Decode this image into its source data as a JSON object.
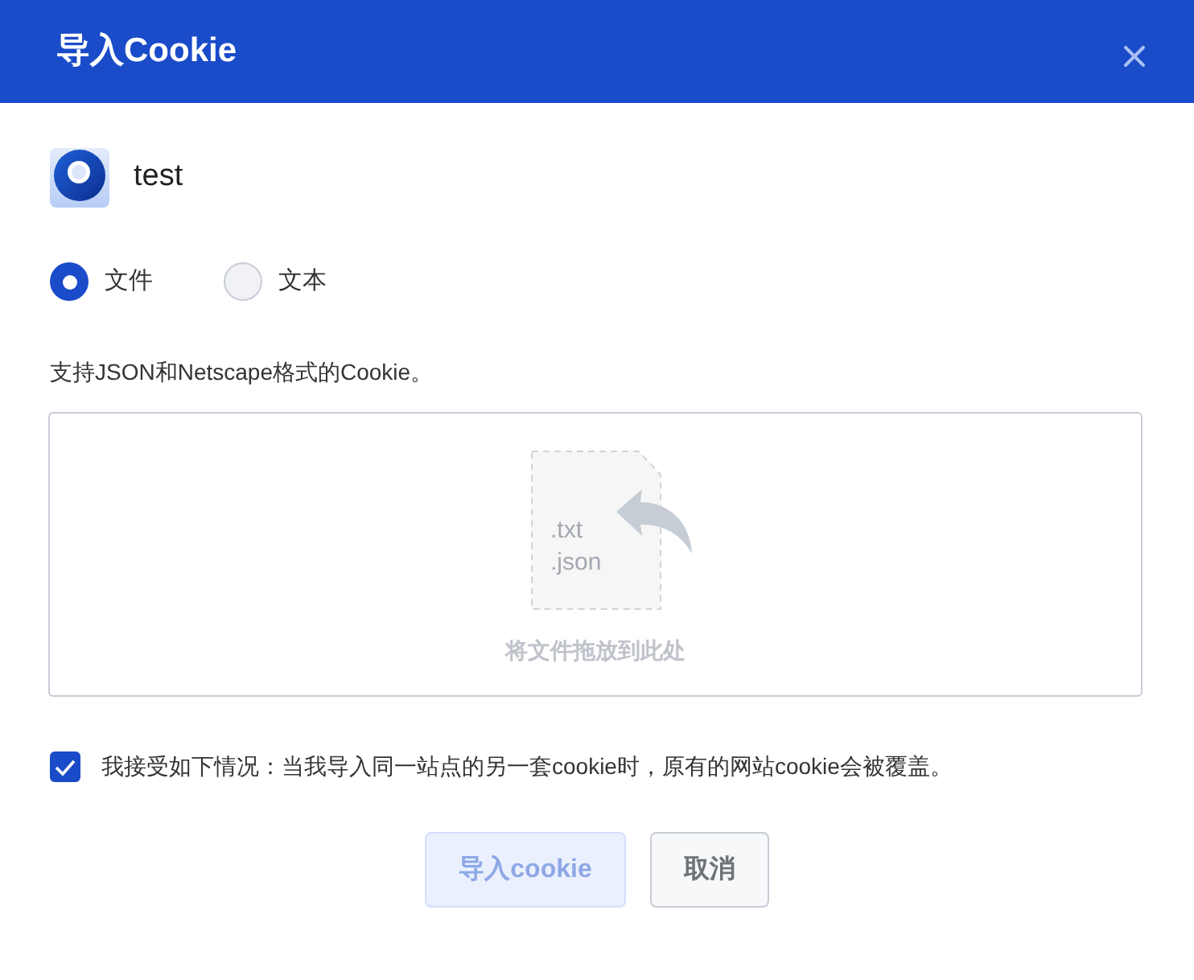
{
  "dialog": {
    "title": "导入Cookie"
  },
  "profile": {
    "name": "test"
  },
  "source_options": [
    {
      "label": "文件",
      "selected": true
    },
    {
      "label": "文本",
      "selected": false
    }
  ],
  "help_text": "支持JSON和Netscape格式的Cookie。",
  "drop_zone": {
    "file_types": [
      ".txt",
      ".json"
    ],
    "hint": "将文件拖放到此处"
  },
  "agreement": {
    "label": "我接受如下情况：当我导入同一站点的另一套cookie时，原有的网站cookie会被覆盖。",
    "checked": true
  },
  "buttons": [
    {
      "label": "导入cookie",
      "kind": "primary",
      "disabled": true
    },
    {
      "label": "取消",
      "kind": "secondary",
      "disabled": false
    }
  ]
}
